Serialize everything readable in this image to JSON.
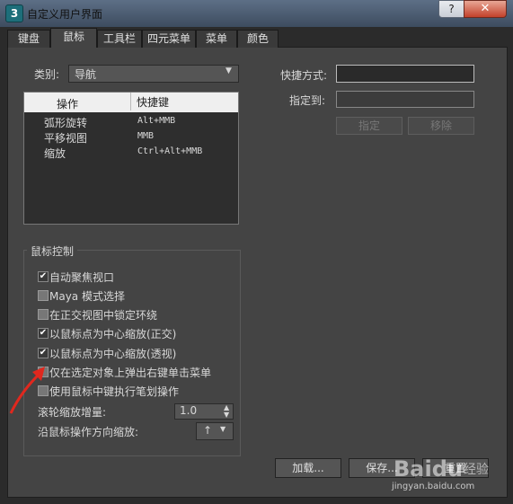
{
  "window": {
    "icon_text": "3",
    "title": "自定义用户界面",
    "help_label": "?",
    "close_label": "✕"
  },
  "tabs": [
    {
      "label": "键盘"
    },
    {
      "label": "鼠标"
    },
    {
      "label": "工具栏"
    },
    {
      "label": "四元菜单"
    },
    {
      "label": "菜单"
    },
    {
      "label": "颜色"
    }
  ],
  "active_tab": "鼠标",
  "category": {
    "label": "类别:",
    "value": "导航"
  },
  "table": {
    "headers": [
      "操作",
      "快捷键"
    ],
    "rows": [
      {
        "action": "弧形旋转",
        "shortcut": "Alt+MMB"
      },
      {
        "action": "平移视图",
        "shortcut": "MMB"
      },
      {
        "action": "缩放",
        "shortcut": "Ctrl+Alt+MMB"
      }
    ]
  },
  "shortcut": {
    "label": "快捷方式:",
    "value": ""
  },
  "assigned": {
    "label": "指定到:",
    "value": ""
  },
  "assign_button": "指定",
  "remove_button": "移除",
  "mouse_control": {
    "title": "鼠标控制",
    "checkboxes": [
      {
        "label": "自动聚焦视口",
        "checked": true
      },
      {
        "label": "Maya 模式选择",
        "checked": false
      },
      {
        "label": "在正交视图中锁定环绕",
        "checked": false
      },
      {
        "label": "以鼠标点为中心缩放(正交)",
        "checked": true
      },
      {
        "label": "以鼠标点为中心缩放(透视)",
        "checked": true
      },
      {
        "label": "仅在选定对象上弹出右键单击菜单",
        "checked": false
      },
      {
        "label": "使用鼠标中键执行笔划操作",
        "checked": false
      }
    ],
    "wheel_label": "滚轮缩放增量:",
    "wheel_value": "1.0",
    "direction_label": "沿鼠标操作方向缩放:",
    "direction_value": "↑"
  },
  "buttons": {
    "load": "加载...",
    "save": "保存...",
    "reset": "重置"
  },
  "watermark": {
    "brand": "Baidu",
    "sub": "经验",
    "url": "jingyan.baidu.com"
  },
  "colors": {
    "annotation_arrow": "#e0281e"
  }
}
